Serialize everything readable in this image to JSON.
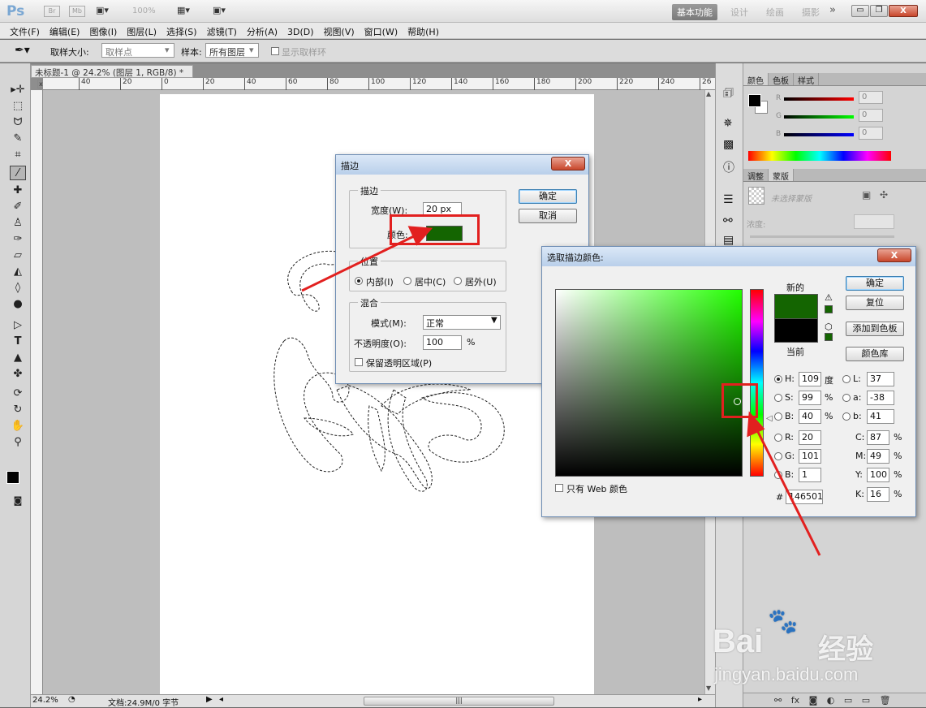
{
  "app": {
    "logo": "Ps",
    "bridge_btn": "Br",
    "minibridge_btn": "Mb",
    "zoom_level": "100%",
    "workspace_active": "基本功能",
    "workspace_items": [
      "设计",
      "绘画",
      "摄影"
    ],
    "more": "»"
  },
  "menu": [
    "文件(F)",
    "编辑(E)",
    "图像(I)",
    "图层(L)",
    "选择(S)",
    "滤镜(T)",
    "分析(A)",
    "3D(D)",
    "视图(V)",
    "窗口(W)",
    "帮助(H)"
  ],
  "options": {
    "sample_size_label": "取样大小:",
    "sample_size_value": "取样点",
    "sample_label": "样本:",
    "sample_value": "所有图层",
    "show_ring_label": "显示取样环"
  },
  "document": {
    "tab_title": "未标题-1 @ 24.2% (图层 1, RGB/8) *",
    "ruler_marks": [
      "40",
      "20",
      "0",
      "20",
      "40",
      "60",
      "80",
      "100",
      "120",
      "140",
      "160",
      "180",
      "200",
      "220",
      "240",
      "26"
    ],
    "status_zoom": "24.2%",
    "status_doc": "文档:24.9M/0 字节"
  },
  "panels": {
    "tabs_top": [
      "颜色",
      "色板",
      "样式"
    ],
    "color_channels": [
      {
        "label": "R",
        "value": "0"
      },
      {
        "label": "G",
        "value": "0"
      },
      {
        "label": "B",
        "value": "0"
      }
    ],
    "tabs_mid": [
      "调整",
      "蒙版"
    ],
    "mask_text": "未选择蒙版",
    "density_label": "浓度:"
  },
  "stroke_dialog": {
    "title": "描边",
    "close": "X",
    "stroke_group": "描边",
    "width_label": "宽度(W):",
    "width_value": "20 px",
    "color_label": "颜色:",
    "color_value": "#146501",
    "ok": "确定",
    "cancel": "取消",
    "position_group": "位置",
    "pos_inside": "内部(I)",
    "pos_center": "居中(C)",
    "pos_outside": "居外(U)",
    "blend_group": "混合",
    "mode_label": "模式(M):",
    "mode_value": "正常",
    "opacity_label": "不透明度(O):",
    "opacity_value": "100",
    "opacity_unit": "%",
    "preserve_label": "保留透明区域(P)"
  },
  "picker_dialog": {
    "title": "选取描边颜色:",
    "close": "X",
    "new_label": "新的",
    "current_label": "当前",
    "new_color": "#146501",
    "current_color": "#000000",
    "ok": "确定",
    "reset": "复位",
    "add_swatch": "添加到色板",
    "color_lib": "颜色库",
    "web_only": "只有 Web 颜色",
    "fields_left": [
      {
        "label": "H:",
        "value": "109",
        "unit": "度",
        "checked": true
      },
      {
        "label": "S:",
        "value": "99",
        "unit": "%",
        "checked": false
      },
      {
        "label": "B:",
        "value": "40",
        "unit": "%",
        "checked": false
      },
      {
        "label": "R:",
        "value": "20",
        "unit": "",
        "checked": false
      },
      {
        "label": "G:",
        "value": "101",
        "unit": "",
        "checked": false
      },
      {
        "label": "B:",
        "value": "1",
        "unit": "",
        "checked": false
      }
    ],
    "fields_lab": [
      {
        "label": "L:",
        "value": "37"
      },
      {
        "label": "a:",
        "value": "-38"
      },
      {
        "label": "b:",
        "value": "41"
      }
    ],
    "fields_cmyk": [
      {
        "label": "C:",
        "value": "87",
        "unit": "%"
      },
      {
        "label": "M:",
        "value": "49",
        "unit": "%"
      },
      {
        "label": "Y:",
        "value": "100",
        "unit": "%"
      },
      {
        "label": "K:",
        "value": "16",
        "unit": "%"
      }
    ],
    "hex_label": "#",
    "hex_value": "146501"
  },
  "watermark": {
    "brand": "Bai",
    "brand2": "经验",
    "url": "jingyan.baidu.com"
  },
  "colors": {
    "accent_red": "#e2201f",
    "stroke_green": "#146501",
    "pure_green": "#22ff00"
  }
}
